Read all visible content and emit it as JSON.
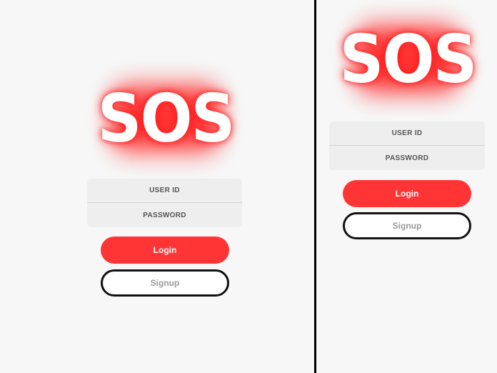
{
  "screens": [
    {
      "logo": "SOS",
      "user_id_placeholder": "USER ID",
      "password_placeholder": "PASSWORD",
      "login_label": "Login",
      "signup_label": "Signup"
    },
    {
      "logo": "SOS",
      "user_id_placeholder": "USER ID",
      "password_placeholder": "PASSWORD",
      "login_label": "Login",
      "signup_label": "Signup"
    }
  ],
  "colors": {
    "accent": "#ff3535",
    "background": "#f7f7f7",
    "field_background": "#eeeeee",
    "signup_text": "#9a9a9a"
  }
}
